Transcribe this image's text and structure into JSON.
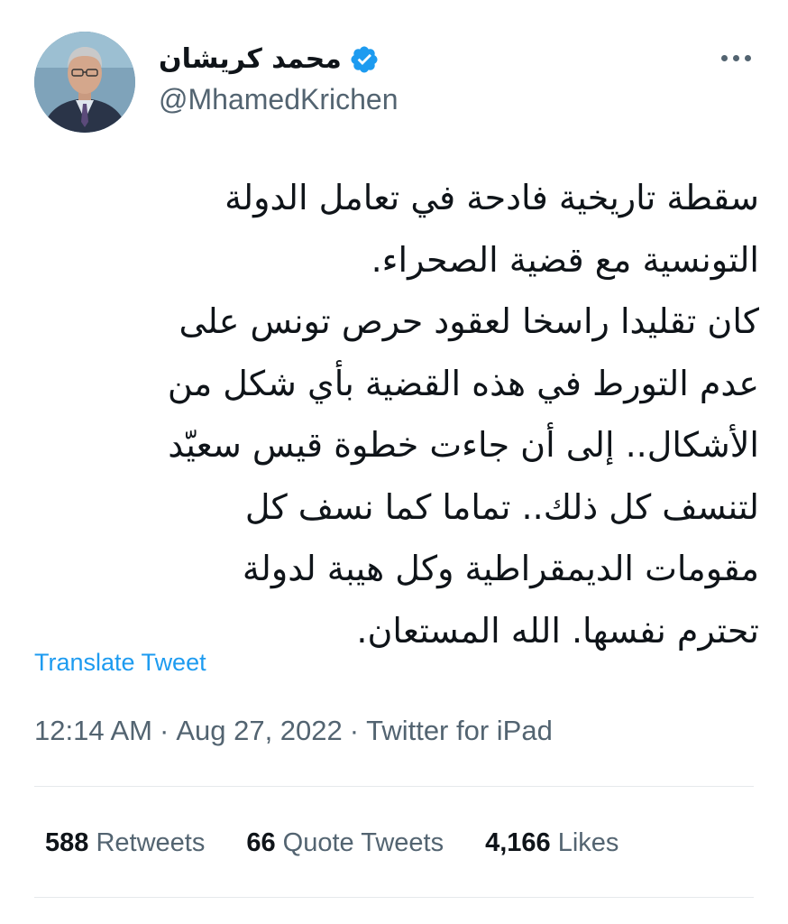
{
  "author": {
    "display_name": "محمد كريشان",
    "handle": "@MhamedKrichen",
    "verified_icon": "verified-badge-icon",
    "avatar_icon": "profile-photo"
  },
  "menu_icon": "more-options-icon",
  "tweet": {
    "lines": [
      "سقطة تاريخية فادحة في تعامل الدولة",
      "التونسية مع قضية الصحراء.",
      "كان تقليدا راسخا لعقود حرص تونس على",
      "عدم التورط في هذه القضية بأي شكل من",
      "الأشكال.. إلى أن جاءت خطوة قيس سعيّد",
      "لتنسف كل ذلك.. تماما كما نسف كل",
      "مقومات الديمقراطية وكل هيبة لدولة",
      "تحترم نفسها. الله المستعان."
    ]
  },
  "translate_label": "Translate Tweet",
  "meta": {
    "time": "12:14 AM",
    "date": "Aug 27, 2022",
    "source": "Twitter for iPad",
    "separator": "·"
  },
  "stats": {
    "retweets_count": "588",
    "retweets_label": "Retweets",
    "quotes_count": "66",
    "quotes_label": "Quote Tweets",
    "likes_count": "4,166",
    "likes_label": "Likes"
  },
  "colors": {
    "link": "#1d9bf0",
    "secondary_text": "#536471",
    "primary_text": "#0f1419",
    "divider": "#e6e9ec"
  }
}
